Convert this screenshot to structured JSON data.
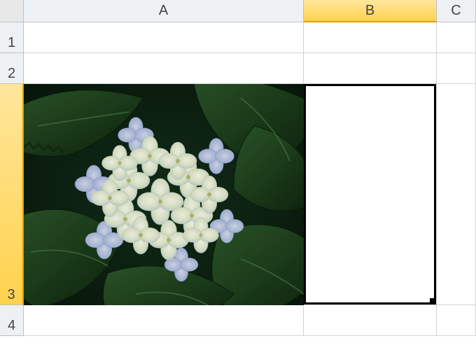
{
  "columns": {
    "A": {
      "label": "A",
      "selected": false
    },
    "B": {
      "label": "B",
      "selected": true
    },
    "C": {
      "label": "C",
      "selected": false
    }
  },
  "rows": {
    "1": {
      "label": "1",
      "selected": false
    },
    "2": {
      "label": "2",
      "selected": false
    },
    "3": {
      "label": "3",
      "selected": true
    },
    "4": {
      "label": "4",
      "selected": false
    }
  },
  "selected_cell": "B3",
  "image": {
    "cell": "A3",
    "description": "A photograph of a hydrangea flower cluster with pale blue-white petals surrounded by dark green serrated leaves."
  }
}
